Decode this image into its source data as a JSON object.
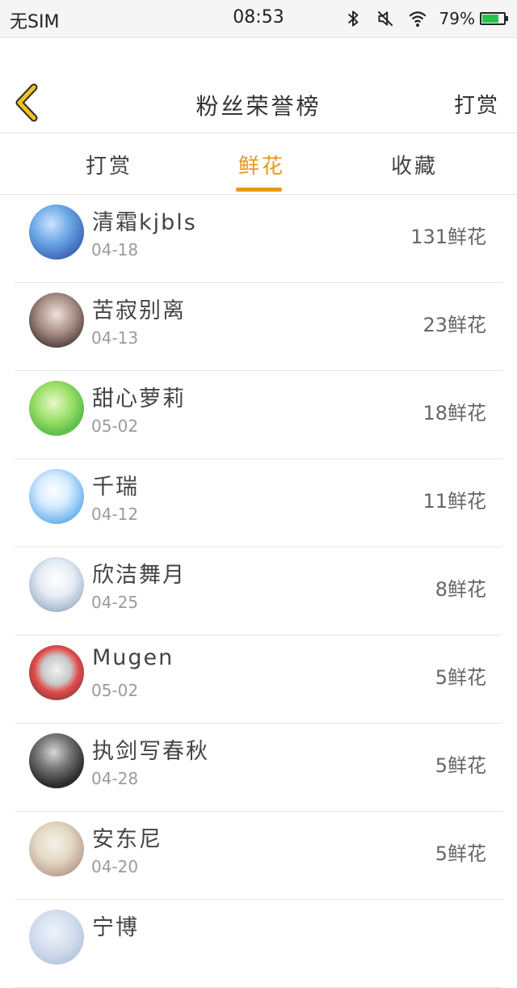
{
  "status_bar": {
    "carrier": "无SIM",
    "time": "08:53",
    "battery": "79%",
    "battery_level": 0.79,
    "icons": [
      "bluetooth-icon",
      "mute-icon",
      "wifi-icon",
      "battery-icon"
    ]
  },
  "header": {
    "title": "粉丝荣誉榜",
    "action": "打赏",
    "back_icon": "chevron-left-icon",
    "accent_color": "#f2c21a"
  },
  "tabs": [
    {
      "label": "打赏",
      "active": false
    },
    {
      "label": "鲜花",
      "active": true
    },
    {
      "label": "收藏",
      "active": false
    }
  ],
  "tab_active_color": "#e89a17",
  "fans": [
    {
      "name": "清霜kjbls",
      "date": "04-18",
      "amount": "131鲜花"
    },
    {
      "name": "苦寂别离",
      "date": "04-13",
      "amount": "23鲜花"
    },
    {
      "name": "甜心萝莉",
      "date": "05-02",
      "amount": "18鲜花"
    },
    {
      "name": "千瑞",
      "date": "04-12",
      "amount": "11鲜花"
    },
    {
      "name": "欣洁舞月",
      "date": "04-25",
      "amount": "8鲜花"
    },
    {
      "name": "Mugen",
      "date": "05-02",
      "amount": "5鲜花"
    },
    {
      "name": "执剑写春秋",
      "date": "04-28",
      "amount": "5鲜花"
    },
    {
      "name": "安东尼",
      "date": "04-20",
      "amount": "5鲜花"
    },
    {
      "name": "宁博",
      "date": "",
      "amount": ""
    }
  ]
}
